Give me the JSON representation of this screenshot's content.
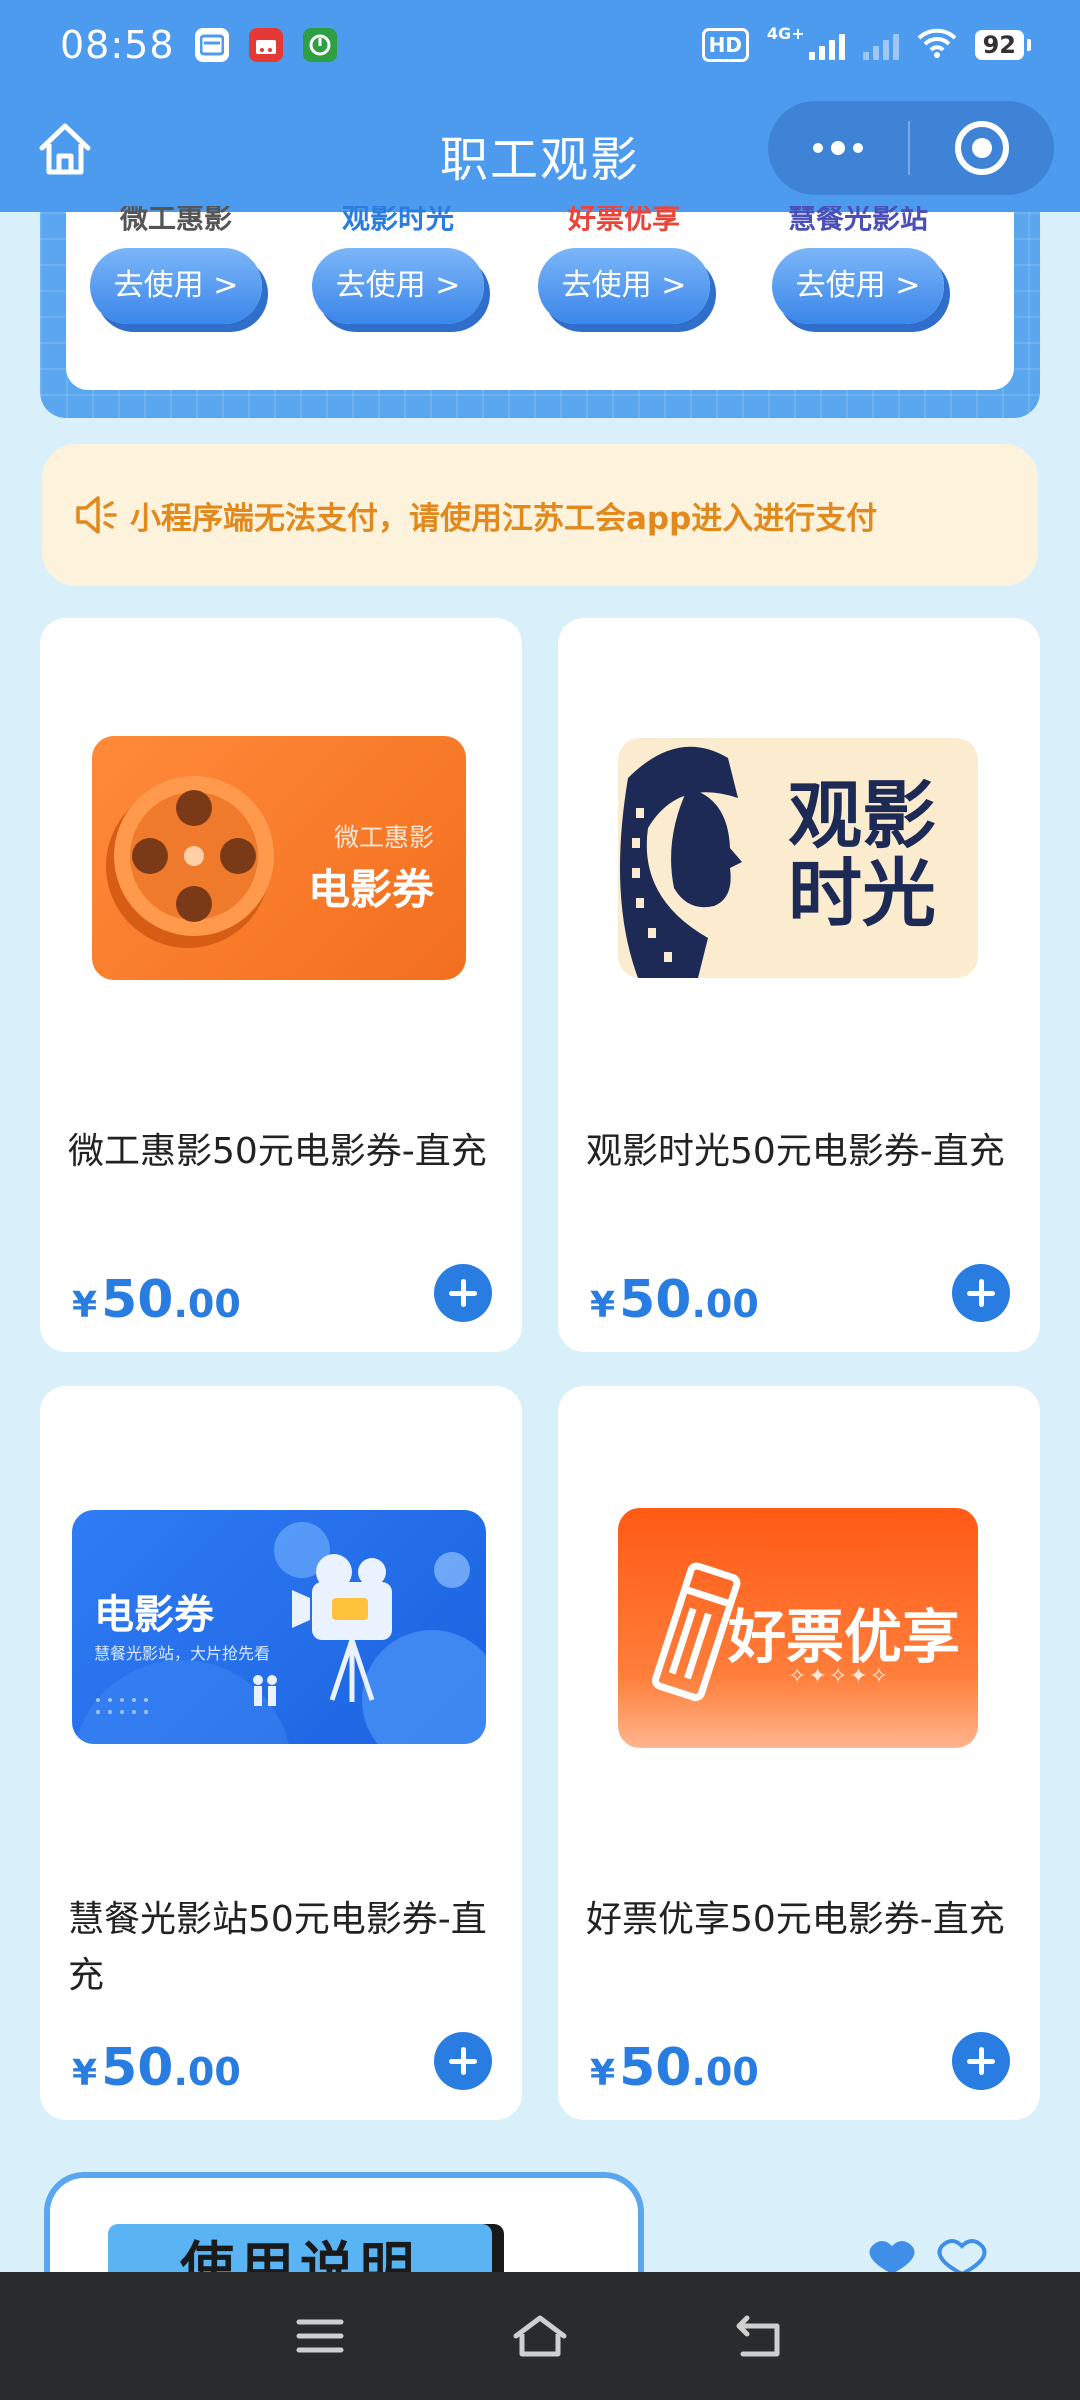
{
  "status_bar": {
    "time": "08:58",
    "hd_label": "HD",
    "network": "4G+",
    "battery": "92"
  },
  "title_bar": {
    "title": "职工观影"
  },
  "brands": [
    {
      "name": "微工惠影",
      "color": "#555555",
      "button": "去使用 >"
    },
    {
      "name": "观影时光",
      "color": "#2a7de0",
      "button": "去使用 >"
    },
    {
      "name": "好票优享",
      "color": "#e8463a",
      "button": "去使用 >"
    },
    {
      "name": "慧餐光影站",
      "color": "#4b4fb8",
      "button": "去使用 >"
    }
  ],
  "notice": {
    "text": "小程序端无法支付，请使用江苏工会app进入进行支付"
  },
  "products": [
    {
      "name": "微工惠影50元电影券-直充",
      "currency": "¥",
      "price_int": "50",
      "price_dec": ".00",
      "image": {
        "subtitle": "微工惠影",
        "title": "电影券",
        "icon": "film-reel-icon"
      }
    },
    {
      "name": "观影时光50元电影券-直充",
      "currency": "¥",
      "price_int": "50",
      "price_dec": ".00",
      "image": {
        "line1": "观影",
        "line2": "时光",
        "icon": "film-strip-portrait-icon"
      }
    },
    {
      "name": "慧餐光影站50元电影券-直充",
      "currency": "¥",
      "price_int": "50",
      "price_dec": ".00",
      "image": {
        "title": "电影券",
        "subtitle": "慧餐光影站，大片抢先看",
        "icon": "movie-camera-icon"
      }
    },
    {
      "name": "好票优享50元电影券-直充",
      "currency": "¥",
      "price_int": "50",
      "price_dec": ".00",
      "image": {
        "title": "好票优享",
        "decoration": "✧✦✧✦✧",
        "icon": "ticket-icon"
      }
    }
  ],
  "instructions": {
    "title": "使用说明"
  },
  "colors": {
    "header": "#4d9bee",
    "accent": "#2a7de0",
    "notice_text": "#e1891c",
    "notice_bg": "#fdf2dc",
    "page_bg": "#d9f0fb"
  }
}
